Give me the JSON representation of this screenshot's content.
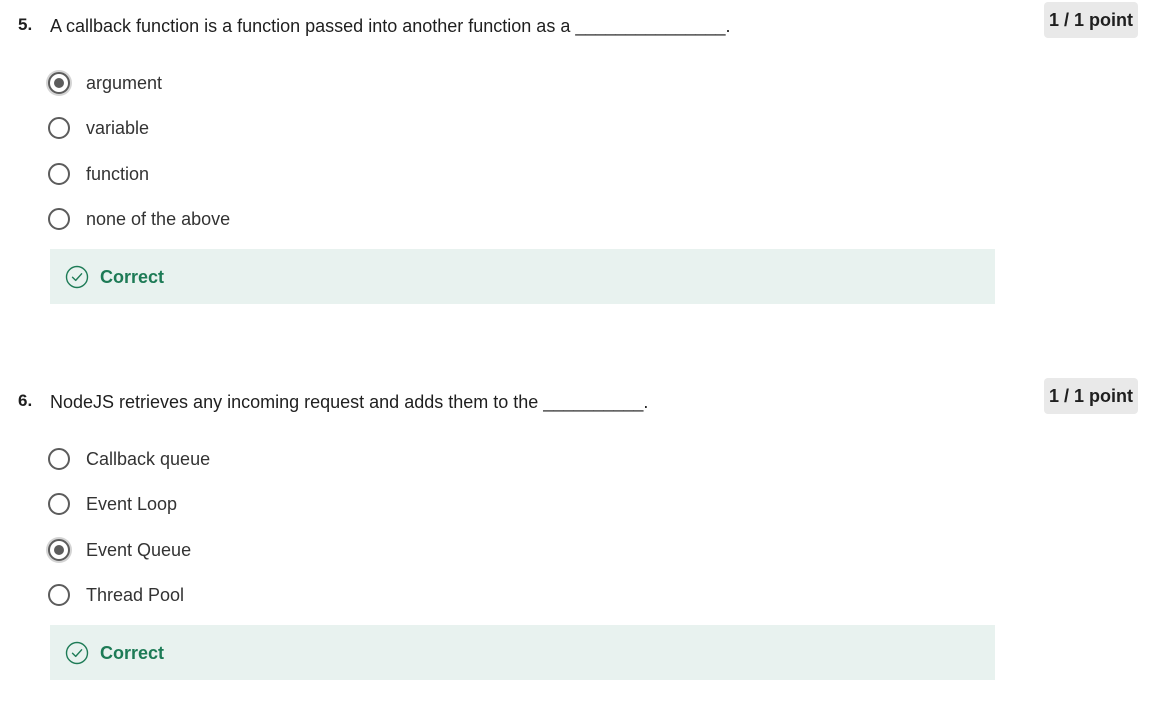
{
  "questions": [
    {
      "number": "5.",
      "text": "A callback function is a function passed into another function as a _______________.",
      "points": "1 / 1 point",
      "options": [
        {
          "label": "argument",
          "selected": true
        },
        {
          "label": "variable",
          "selected": false
        },
        {
          "label": "function",
          "selected": false
        },
        {
          "label": "none of the above",
          "selected": false
        }
      ],
      "feedback": "Correct"
    },
    {
      "number": "6.",
      "text": "NodeJS retrieves any incoming request and adds them to the __________.",
      "points": "1 / 1 point",
      "options": [
        {
          "label": "Callback queue",
          "selected": false
        },
        {
          "label": "Event Loop",
          "selected": false
        },
        {
          "label": "Event Queue",
          "selected": true
        },
        {
          "label": "Thread Pool",
          "selected": false
        }
      ],
      "feedback": "Correct"
    }
  ],
  "colors": {
    "feedback_bg": "#e8f2ef",
    "feedback_text": "#1d7b56",
    "badge_bg": "#e9e9e9",
    "radio_border": "#5c5c5c"
  },
  "icons": {
    "feedback": "check-circle-icon"
  }
}
